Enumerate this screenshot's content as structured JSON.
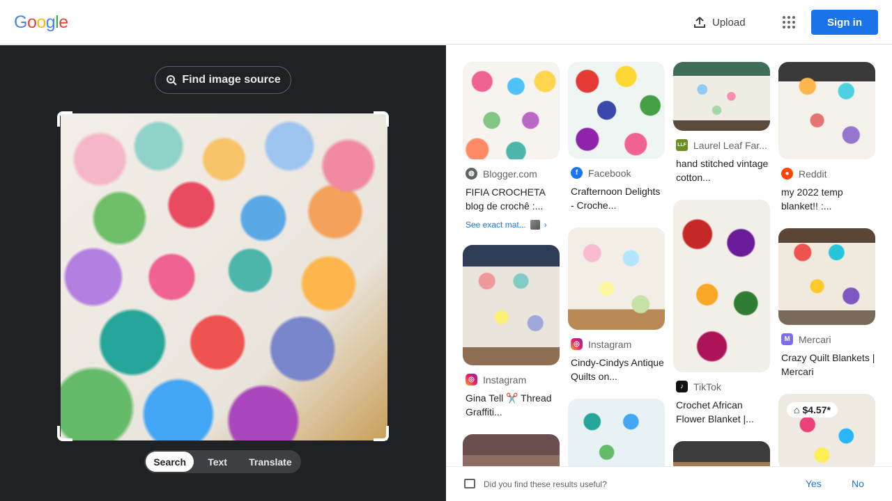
{
  "header": {
    "logo_letters": [
      "G",
      "o",
      "o",
      "g",
      "l",
      "e"
    ],
    "logo_colors": [
      "#4285f4",
      "#ea4335",
      "#fbbc05",
      "#4285f4",
      "#34a853",
      "#ea4335"
    ],
    "upload_label": "Upload",
    "signin_label": "Sign in"
  },
  "left": {
    "find_source_label": "Find image source",
    "modes": [
      {
        "label": "Search",
        "active": true
      },
      {
        "label": "Text",
        "active": false
      },
      {
        "label": "Translate",
        "active": false
      }
    ]
  },
  "results": {
    "col1": [
      {
        "source": "Blogger.com",
        "source_icon": "globe-icon",
        "title": "FIFIA CROCHETA blog de crochê :...",
        "exact_label": "See exact mat..."
      },
      {
        "source": "Instagram",
        "source_icon": "instagram-icon",
        "title": "Gina Tell ✂️ Thread Graffiti..."
      }
    ],
    "col2": [
      {
        "source": "Facebook",
        "source_icon": "facebook-icon",
        "title": "Crafternoon Delights - Croche..."
      },
      {
        "source": "Instagram",
        "source_icon": "instagram-icon",
        "title": "Cindy-Cindys Antique Quilts on..."
      }
    ],
    "col3": [
      {
        "source": "Laurel Leaf Far...",
        "source_icon": "llf-icon",
        "title": "hand stitched vintage cotton..."
      },
      {
        "source": "TikTok",
        "source_icon": "tiktok-icon",
        "title": "Crochet African Flower Blanket |..."
      }
    ],
    "col4": [
      {
        "source": "Reddit",
        "source_icon": "reddit-icon",
        "title": "my 2022 temp blanket!! :..."
      },
      {
        "source": "Mercari",
        "source_icon": "mercari-icon",
        "title": "Crazy Quilt Blankets | Mercari"
      },
      {
        "price": "$4.57*"
      }
    ]
  },
  "footer": {
    "question": "Did you find these results useful?",
    "yes_label": "Yes",
    "no_label": "No"
  },
  "colors": {
    "accent": "#1a73e8",
    "dark_panel": "#202124"
  }
}
